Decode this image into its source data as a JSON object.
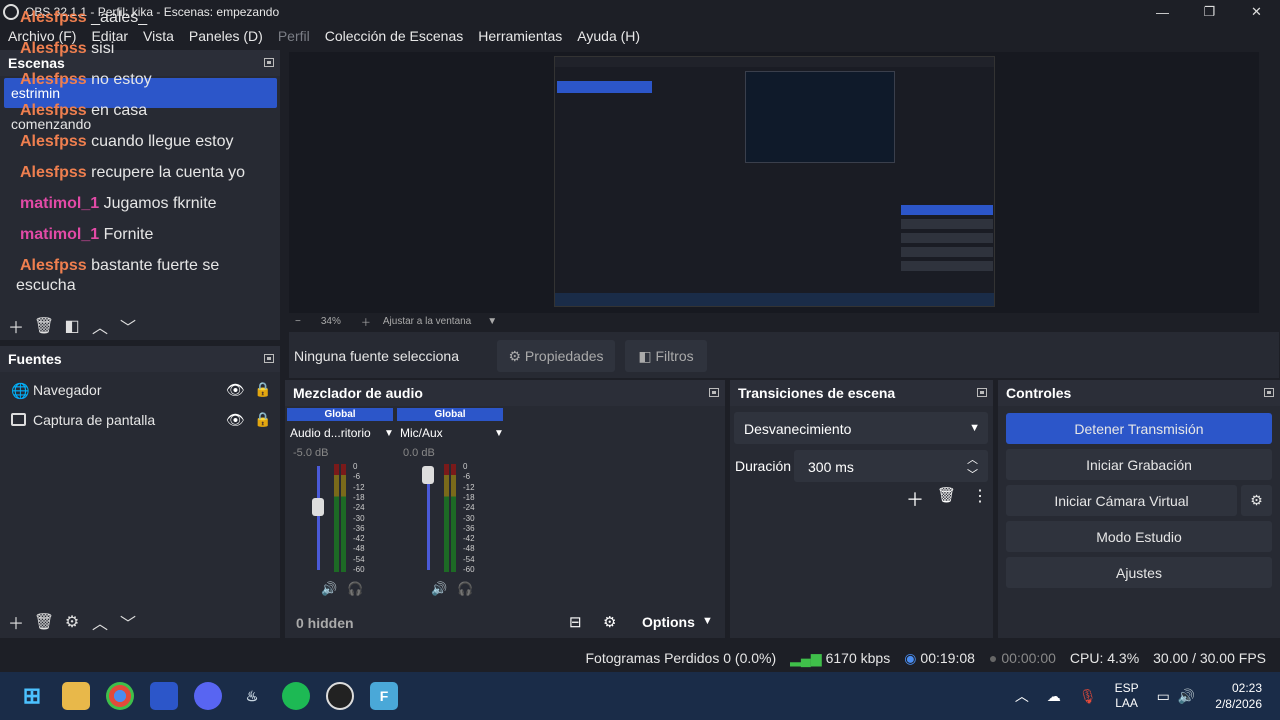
{
  "window": {
    "title": "OBS 32.1.1 - Perfil: kika - Escenas: empezando",
    "controls": [
      "—",
      "❐",
      "✕"
    ]
  },
  "menu": [
    {
      "label": "Archivo (F)",
      "dim": false
    },
    {
      "label": "Editar",
      "dim": false
    },
    {
      "label": "Vista",
      "dim": false
    },
    {
      "label": "Paneles (D)",
      "dim": false
    },
    {
      "label": "Perfil",
      "dim": true
    },
    {
      "label": "Colección de Escenas",
      "dim": false
    },
    {
      "label": "Herramientas",
      "dim": false
    },
    {
      "label": "Ayuda (H)",
      "dim": false
    }
  ],
  "scenes": {
    "title": "Escenas",
    "items": [
      "estrimin",
      "comenzando"
    ],
    "selected": 0
  },
  "chat": [
    {
      "user": "Alesfpss",
      "msg": "_aales_",
      "color": "orange"
    },
    {
      "user": "Alesfpss",
      "msg": "sisi",
      "color": "orange"
    },
    {
      "user": "Alesfpss",
      "msg": "no estoy",
      "color": "orange"
    },
    {
      "user": "Alesfpss",
      "msg": "en casa",
      "color": "orange"
    },
    {
      "user": "Alesfpss",
      "msg": "cuando llegue estoy",
      "color": "orange"
    },
    {
      "user": "Alesfpss",
      "msg": "recupere la cuenta yo",
      "color": "orange"
    },
    {
      "user": "matimol_1",
      "msg": "Jugamos fkrnite",
      "color": "pink"
    },
    {
      "user": "matimol_1",
      "msg": "Fornite",
      "color": "pink"
    },
    {
      "user": "Alesfpss",
      "msg": "bastante fuerte se",
      "color": "orange"
    }
  ],
  "chat_wrap": "escucha",
  "preview_bar": {
    "zoom": "34%",
    "fit": "Ajustar a la ventana"
  },
  "source_bar": {
    "none": "Ninguna fuente selecciona",
    "props": "Propiedades",
    "filters": "Filtros"
  },
  "sources": {
    "title": "Fuentes",
    "items": [
      {
        "name": "Navegador"
      },
      {
        "name": "Captura de pantalla"
      }
    ]
  },
  "mixer": {
    "title": "Mezclador de audio",
    "channels": [
      {
        "header": "Global",
        "name": "Audio d...ritorio",
        "db": "-5.0 dB",
        "level": 0.62
      },
      {
        "header": "Global",
        "name": "Mic/Aux",
        "db": "0.0 dB",
        "level": 0.92
      }
    ],
    "scale": [
      "0",
      "-6",
      "-12",
      "-18",
      "-24",
      "-30",
      "-36",
      "-42",
      "-48",
      "-54",
      "-60"
    ],
    "hidden": "0 hidden",
    "options": "Options"
  },
  "transitions": {
    "title": "Transiciones de escena",
    "selected": "Desvanecimiento",
    "duration_label": "Duración",
    "duration": "300 ms"
  },
  "controls": {
    "title": "Controles",
    "stop": "Detener Transmisión",
    "record": "Iniciar Grabación",
    "virtual": "Iniciar Cámara Virtual",
    "studio": "Modo Estudio",
    "settings": "Ajustes"
  },
  "status": {
    "dropped": "Fotogramas Perdidos 0 (0.0%)",
    "bitrate": "6170 kbps",
    "stream_time": "00:19:08",
    "rec_time": "00:00:00",
    "cpu": "CPU: 4.3%",
    "fps": "30.00 / 30.00 FPS"
  },
  "tray": {
    "lang1": "ESP",
    "lang2": "LAA",
    "time": "02:23",
    "date": "2/8/2026"
  },
  "colors": {
    "accent": "#2c56c9",
    "orange": "#ef7f4f",
    "pink": "#e24aa6",
    "green": "#3fbf4a"
  }
}
